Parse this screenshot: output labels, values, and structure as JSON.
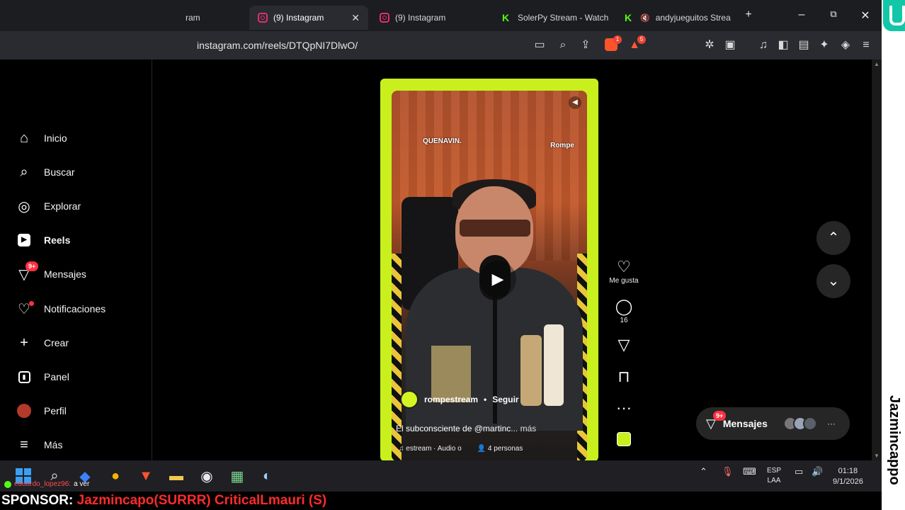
{
  "browser": {
    "tabs": [
      {
        "label": "ram",
        "icon": "instagram-icon",
        "active": false
      },
      {
        "label": "(9) Instagram",
        "icon": "instagram-icon",
        "active": true
      },
      {
        "label": "(9) Instagram",
        "icon": "instagram-icon",
        "active": false
      },
      {
        "label": "SolerPy Stream - Watch",
        "icon": "kick-icon",
        "active": false
      },
      {
        "label": "andyjueguitos Strea",
        "icon": "kick-icon",
        "active": false
      }
    ],
    "new_tab": "+",
    "window_controls": {
      "minimize": "–",
      "restore": "⧉",
      "close": "✕"
    },
    "url": "instagram.com/reels/DTQpNI7DlwO/",
    "brave_shield_count": "1",
    "rewards_count": "5"
  },
  "sidebar": {
    "items": [
      {
        "label": "Inicio",
        "icon": "home-icon"
      },
      {
        "label": "Buscar",
        "icon": "search-icon"
      },
      {
        "label": "Explorar",
        "icon": "compass-icon"
      },
      {
        "label": "Reels",
        "icon": "reels-icon",
        "active": true
      },
      {
        "label": "Mensajes",
        "icon": "messages-icon",
        "badge": "9+"
      },
      {
        "label": "Notificaciones",
        "icon": "heart-icon"
      },
      {
        "label": "Crear",
        "icon": "plus-icon"
      },
      {
        "label": "Panel",
        "icon": "dashboard-icon"
      },
      {
        "label": "Perfil",
        "icon": "profile-avatar-icon"
      },
      {
        "label": "Más",
        "icon": "menu-icon"
      }
    ]
  },
  "reel": {
    "brand_left": "QUENAVIN.",
    "brand_right": "Rompe",
    "author": "rompestream",
    "separator": "•",
    "follow": "Seguir",
    "caption": "El subconsciente de @martinc",
    "caption_more": "... más",
    "audio": "estream · Audio o",
    "people": "4 personas",
    "actions": {
      "like_label": "Me gusta",
      "comments_count": "16"
    }
  },
  "messages_pill": {
    "label": "Mensajes",
    "badge": "9+"
  },
  "taskbar": {
    "chat_user": "eduardo_lopez96:",
    "chat_text": "a ver",
    "lang_top": "ESP",
    "lang_bottom": "LAA",
    "time": "01:18",
    "date": "9/1/2026"
  },
  "overlay": {
    "sponsor_label": "SPONSOR:",
    "sponsor_names": "Jazmincapo(SURRR) CriticalLmauri (S)",
    "streamer_name": "Jazmincappo"
  }
}
